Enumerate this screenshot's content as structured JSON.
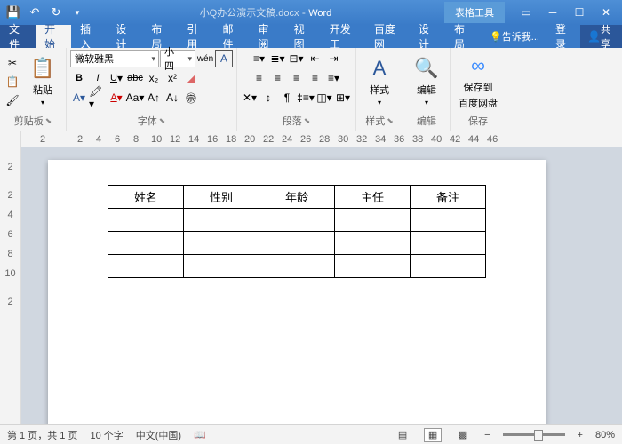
{
  "title": {
    "doc": "小Q办公演示文稿.docx",
    "app": "Word",
    "context": "表格工具"
  },
  "tabs": {
    "file": "文件",
    "home": "开始",
    "insert": "插入",
    "design": "设计",
    "layout": "布局",
    "ref": "引用",
    "mail": "邮件",
    "review": "审阅",
    "view": "视图",
    "dev": "开发工",
    "baidu": "百度网",
    "tdesign": "设计",
    "tlayout": "布局",
    "tell": "告诉我...",
    "login": "登录",
    "share": "共享"
  },
  "font": {
    "name": "微软雅黑",
    "size": "小四"
  },
  "groups": {
    "clipboard": "剪贴板",
    "font": "字体",
    "paragraph": "段落",
    "styles": "样式",
    "editing": "编辑",
    "save": "保存"
  },
  "buttons": {
    "paste": "粘贴",
    "styles": "样式",
    "edit": "编辑",
    "saveto": "保存到",
    "saveto2": "百度网盘"
  },
  "ruler_h": [
    "2",
    "",
    "2",
    "4",
    "6",
    "8",
    "10",
    "12",
    "14",
    "16",
    "18",
    "20",
    "22",
    "24",
    "26",
    "28",
    "30",
    "32",
    "34",
    "36",
    "38",
    "40",
    "42",
    "44",
    "46"
  ],
  "ruler_v": [
    "",
    "2",
    "",
    "2",
    "4",
    "6",
    "8",
    "10",
    "",
    "2"
  ],
  "table": {
    "headers": [
      "姓名",
      "性别",
      "年龄",
      "主任",
      "备注"
    ],
    "rows": 3
  },
  "status": {
    "page": "第 1 页，共 1 页",
    "words": "10 个字",
    "lang": "中文(中国)",
    "zoom": "80%"
  }
}
